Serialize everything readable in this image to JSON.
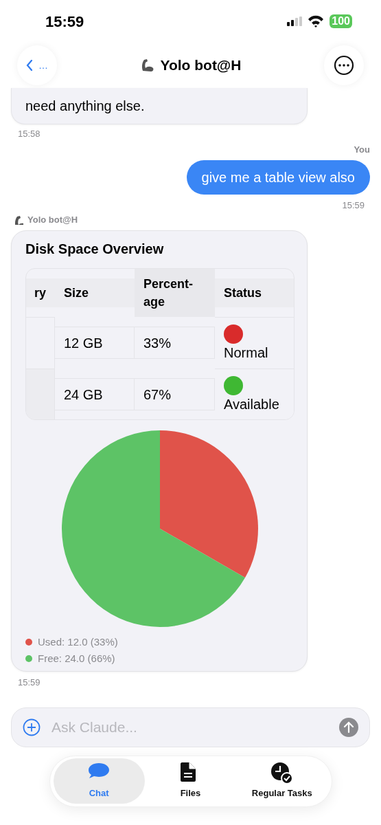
{
  "status_bar": {
    "time": "15:59",
    "battery": "100"
  },
  "header": {
    "back_label": "…",
    "title": "Yolo bot@H"
  },
  "messages": [
    {
      "kind": "bot_text",
      "text": "need anything else.",
      "time": "15:58"
    },
    {
      "kind": "user",
      "sender": "You",
      "text": "give me a table view also",
      "time": "15:59"
    },
    {
      "kind": "bot_card",
      "sender": "Yolo bot@H",
      "title": "Disk Space Overview",
      "time": "15:59",
      "table": {
        "columns": [
          "ry",
          "Size",
          "Percent-\nage",
          "Status"
        ],
        "rows": [
          {
            "cells": [
              "",
              "12 GB",
              "33%",
              "Normal"
            ],
            "color": "#d92b2b"
          },
          {
            "cells": [
              "",
              "24 GB",
              "67%",
              "Available"
            ],
            "color": "#3fb833"
          }
        ]
      },
      "chart_data": {
        "type": "pie",
        "values": [
          33.3,
          66.7
        ]
      },
      "legend": [
        {
          "label": "Used: 12.0 (33%)",
          "color": "#e0534a"
        },
        {
          "label": "Free: 24.0 (66%)",
          "color": "#5dc366"
        }
      ]
    }
  ],
  "composer": {
    "placeholder": "Ask Claude..."
  },
  "tabs": [
    {
      "label": "Chat",
      "kind": "chat",
      "selected": true
    },
    {
      "label": "Files",
      "kind": "file",
      "selected": false
    },
    {
      "label": "Regular Tasks",
      "kind": "clock",
      "selected": false
    }
  ]
}
